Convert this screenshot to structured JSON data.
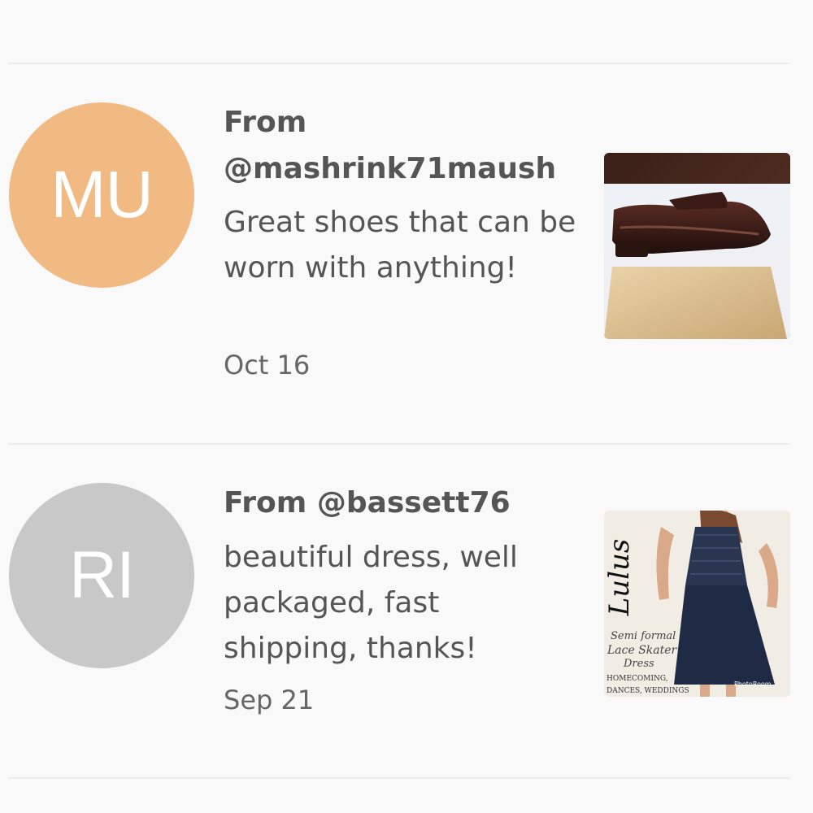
{
  "reviews": [
    {
      "avatar_initials": "MU",
      "avatar_color": "#f0ba82",
      "from": "From @mashrink71maush",
      "comment": "Great shoes that can be worn with anything!",
      "date": "Oct 16",
      "thumbnail_icon": "brown-loafer-shoe"
    },
    {
      "avatar_initials": "RI",
      "avatar_color": "#c8c8c8",
      "from": "From @bassett76",
      "comment": "beautiful dress, well packaged, fast shipping, thanks!",
      "date": "Sep 21",
      "thumbnail_icon": "navy-lace-dress",
      "thumbnail_text": {
        "brand": "Lulus",
        "line1": "Semi formal",
        "line2": "Lace Skater",
        "line3": "Dress",
        "line4": "HOMECOMING,",
        "line5": "DANCES, WEDDINGS",
        "watermark": "PhotoRoom"
      }
    }
  ]
}
